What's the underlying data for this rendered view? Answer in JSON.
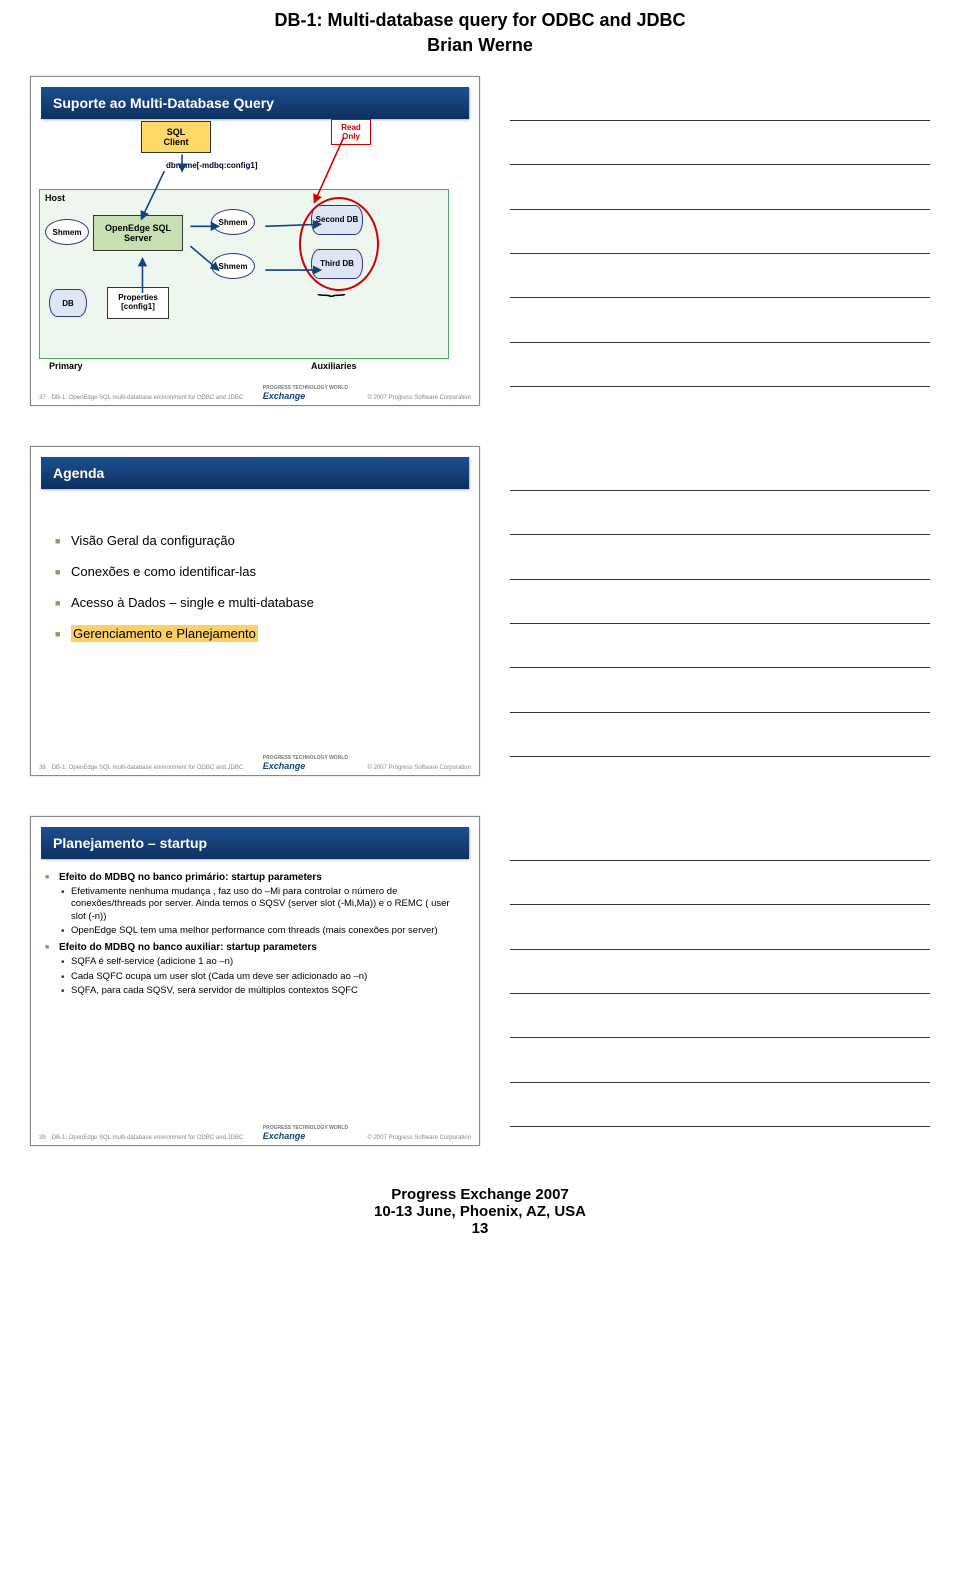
{
  "doc_title": "DB-1: Multi-database query for ODBC and JDBC",
  "doc_author": "Brian Werne",
  "footer_lines": [
    "Progress Exchange 2007",
    "10-13 June, Phoenix, AZ, USA",
    "13"
  ],
  "slide_footer": {
    "ref": "DB-1: OpenEdge SQL multi-database environment for ODBC and JDBC",
    "copy": "© 2007 Progress Software Corporation",
    "logo_main": "Exchange",
    "logo_sub": "PROGRESS TECHNOLOGY WORLD"
  },
  "slide1": {
    "num": "37",
    "title": "Suporte ao Multi-Database Query",
    "sql_client": "SQL\nClient",
    "read_only": "Read Only",
    "dbname": "dbname[-mdbq:config1]",
    "host": "Host",
    "oes": "OpenEdge SQL Server",
    "shmem": "Shmem",
    "db": "DB",
    "props": "Properties",
    "props2": "[config1]",
    "second": "Second DB",
    "third": "Third DB",
    "primary": "Primary",
    "aux": "Auxiliaries"
  },
  "slide2": {
    "num": "38",
    "title": "Agenda",
    "items": [
      "Visão Geral da configuração",
      "Conexões e como identificar-las",
      "Acesso à Dados – single e multi-database",
      "Gerenciamento e Planejamento"
    ]
  },
  "slide3": {
    "num": "39",
    "title": "Planejamento – startup",
    "b1": "Efeito do MDBQ no banco primário: startup parameters",
    "b1s1": "Efetivamente nenhuma mudança , faz uso do –Mi para controlar o número de conexões/threads por server. Ainda temos o SQSV (server slot (-Mi,Ma)) e o REMC ( user slot (-n))",
    "b1s2": "OpenEdge SQL tem uma melhor performance com threads (mais conexões por server)",
    "b2": "Efeito do MDBQ no banco auxiliar: startup parameters",
    "b2s1": "SQFA é self-service (adicione 1 ao –n)",
    "b2s2": "Cada SQFC ocupa um user slot (Cada um deve ser adicionado ao –n)",
    "b2s3": "SQFA, para cada SQSV,  será servidor de múltiplos contextos SQFC"
  }
}
